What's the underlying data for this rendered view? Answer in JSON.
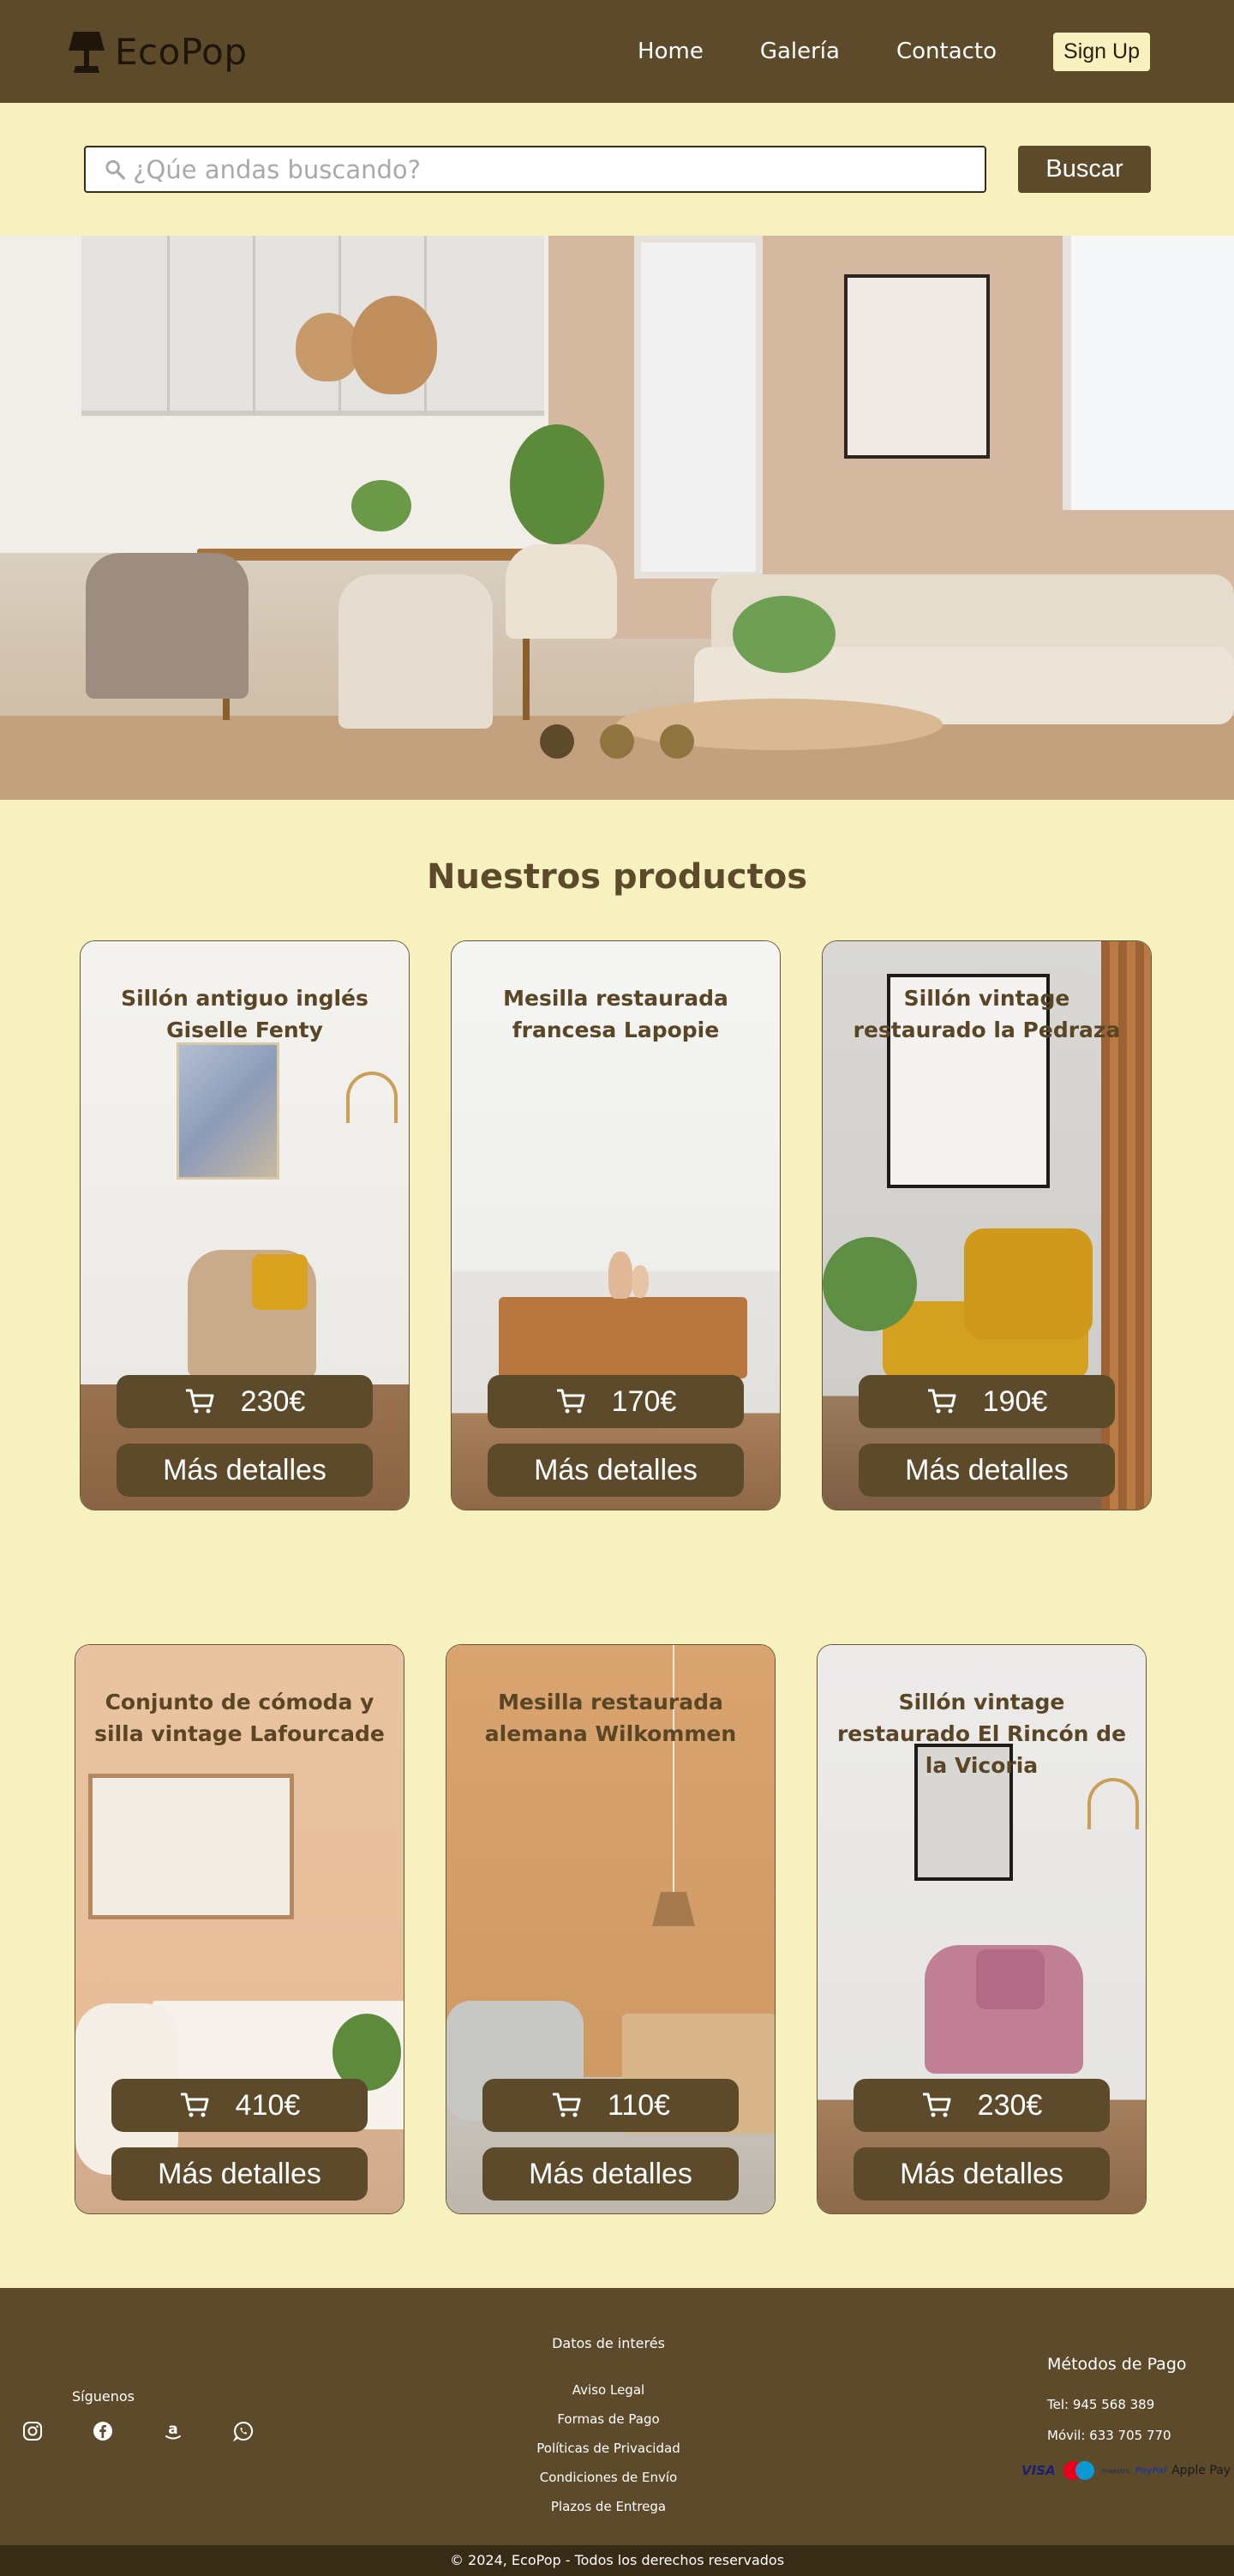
{
  "header": {
    "brand": "EcoPop",
    "nav": [
      "Home",
      "Galería",
      "Contacto"
    ],
    "signup": "Sign Up"
  },
  "search": {
    "placeholder": "¿Qúe andas buscando?",
    "button": "Buscar"
  },
  "hero": {
    "slides": 3,
    "active_slide": 1
  },
  "products": {
    "title": "Nuestros productos",
    "details_label": "Más detalles",
    "items": [
      {
        "name": "Sillón antiguo inglés Giselle Fenty",
        "price": "230€"
      },
      {
        "name": "Mesilla restaurada francesa Lapopie",
        "price": "170€"
      },
      {
        "name": "Sillón vintage restaurado la Pedraza",
        "price": "190€"
      },
      {
        "name": "Conjunto de cómoda y silla vintage Lafourcade",
        "price": "410€"
      },
      {
        "name": "Mesilla restaurada alemana Wilkommen",
        "price": "110€"
      },
      {
        "name": "Sillón vintage restaurado El Rincón de la Vicoria",
        "price": "230€"
      }
    ]
  },
  "footer": {
    "follow": "Síguenos",
    "social_icons": [
      "instagram-icon",
      "facebook-icon",
      "amazon-icon",
      "whatsapp-icon"
    ],
    "links_heading": "Datos de interés",
    "links": [
      "Aviso Legal",
      "Formas de Pago",
      "Políticas de Privacidad",
      "Condiciones de Envío",
      "Plazos de Entrega"
    ],
    "payment_heading": "Métodos de Pago",
    "phone": "Tel: 945 568 389",
    "mobile": "Móvil: 633 705 770",
    "payment_logos": [
      "VISA",
      "maestro",
      "PayPal",
      "Apple Pay"
    ],
    "copyright": "© 2024, EcoPop - Todos los derechos reservados"
  },
  "colors": {
    "background": "#f7f1bf",
    "primary_brown": "#5d4a2b",
    "dark_footer": "#382c17"
  }
}
